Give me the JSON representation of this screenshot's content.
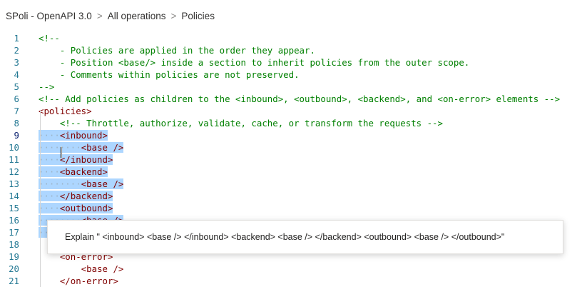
{
  "breadcrumb": {
    "items": [
      "SPoli - OpenAPI 3.0",
      "All operations",
      "Policies"
    ],
    "separator": ">"
  },
  "editor": {
    "lines": [
      {
        "n": "1",
        "indent": "",
        "text": "<!--",
        "kind": "comment"
      },
      {
        "n": "2",
        "indent": "    ",
        "text": "- Policies are applied in the order they appear.",
        "kind": "comment"
      },
      {
        "n": "3",
        "indent": "    ",
        "text": "- Position <base/> inside a section to inherit policies from the outer scope.",
        "kind": "comment"
      },
      {
        "n": "4",
        "indent": "    ",
        "text": "- Comments within policies are not preserved.",
        "kind": "comment"
      },
      {
        "n": "5",
        "indent": "",
        "text": "-->",
        "kind": "comment"
      },
      {
        "n": "6",
        "indent": "",
        "text": "<!-- Add policies as children to the <inbound>, <outbound>, <backend>, and <on-error> elements -->",
        "kind": "comment"
      },
      {
        "n": "7",
        "indent": "",
        "text": "<policies>",
        "kind": "tag"
      },
      {
        "n": "8",
        "indent": "    ",
        "text": "<!-- Throttle, authorize, validate, cache, or transform the requests -->",
        "kind": "comment"
      },
      {
        "n": "9",
        "indent": "····",
        "text": "<inbound>",
        "kind": "tag",
        "selected": true
      },
      {
        "n": "10",
        "indent": "········",
        "text": "<base />",
        "kind": "tag",
        "selected": true
      },
      {
        "n": "11",
        "indent": "····",
        "text": "</inbound>",
        "kind": "tag",
        "selected": true
      },
      {
        "n": "12",
        "indent": "····",
        "text": "<backend>",
        "kind": "tag",
        "selected": true
      },
      {
        "n": "13",
        "indent": "········",
        "text": "<base />",
        "kind": "tag",
        "selected": true
      },
      {
        "n": "14",
        "indent": "····",
        "text": "</backend>",
        "kind": "tag",
        "selected": true
      },
      {
        "n": "15",
        "indent": "····",
        "text": "<outbound>",
        "kind": "tag",
        "selected": true
      },
      {
        "n": "16",
        "indent": "········",
        "text": "<base />",
        "kind": "tag",
        "selected": true
      },
      {
        "n": "17",
        "indent": "····",
        "text": "</outbound>",
        "kind": "tag",
        "selected": true
      },
      {
        "n": "18",
        "indent": "",
        "text": "",
        "kind": "tag"
      },
      {
        "n": "19",
        "indent": "    ",
        "text": "<on-error>",
        "kind": "tag"
      },
      {
        "n": "20",
        "indent": "        ",
        "text": "<base />",
        "kind": "tag"
      },
      {
        "n": "21",
        "indent": "    ",
        "text": "</on-error>",
        "kind": "tag"
      }
    ]
  },
  "popup": {
    "text": "Explain \" <inbound> <base /> </inbound> <backend> <base /> </backend> <outbound> <base /> </outbound>\""
  }
}
